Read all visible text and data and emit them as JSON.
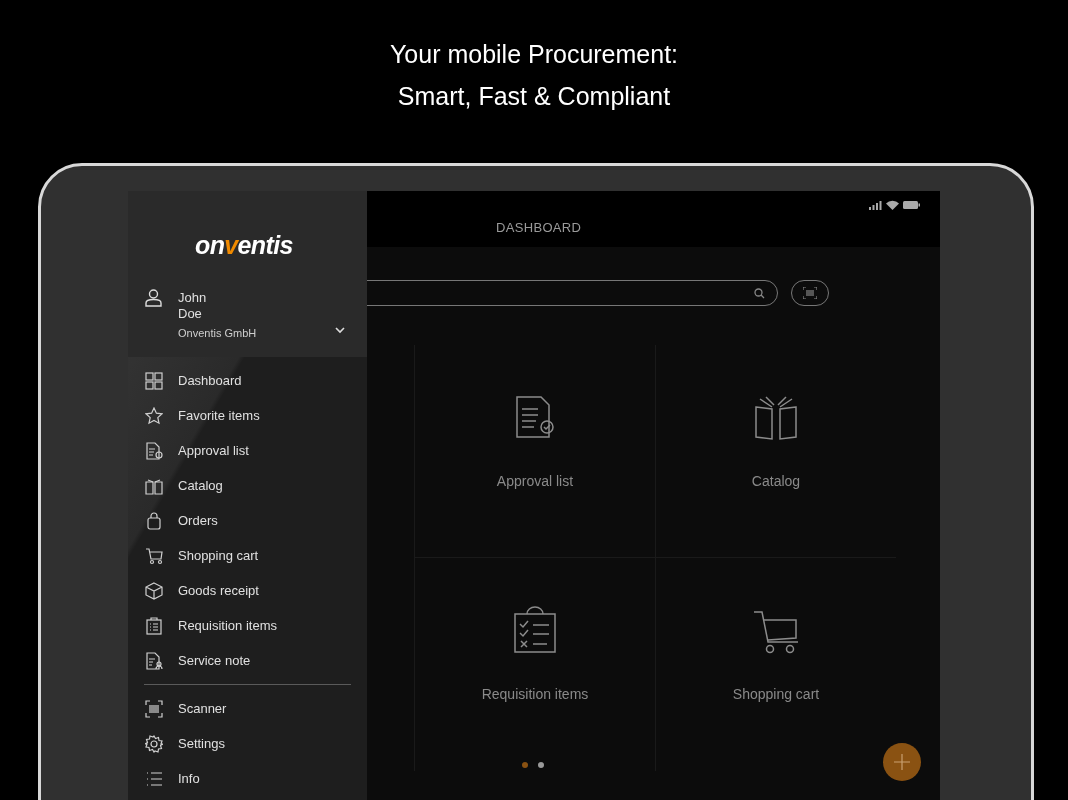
{
  "headline": [
    "Your mobile Procurement:",
    "Smart, Fast & Compliant"
  ],
  "app_bar": {
    "title": "DASHBOARD"
  },
  "drawer": {
    "logo_parts": [
      "on",
      "v",
      "entis"
    ],
    "user": {
      "first_name": "John",
      "last_name": "Doe",
      "company": "Onventis GmbH",
      "expanded": false
    },
    "menu_main": [
      {
        "label": "Dashboard"
      },
      {
        "label": "Favorite items"
      },
      {
        "label": "Approval list"
      },
      {
        "label": "Catalog"
      },
      {
        "label": "Orders"
      },
      {
        "label": "Shopping cart"
      },
      {
        "label": "Goods receipt"
      },
      {
        "label": "Requisition items"
      },
      {
        "label": "Service note"
      }
    ],
    "menu_tools": [
      {
        "label": "Scanner"
      },
      {
        "label": "Settings"
      },
      {
        "label": "Info"
      }
    ]
  },
  "tiles": [
    {
      "label": "Approval list"
    },
    {
      "label": "Catalog"
    },
    {
      "label": "Requisition items"
    },
    {
      "label": "Shopping cart"
    }
  ],
  "page_dots": [
    {
      "selected": true
    },
    {
      "selected": false
    }
  ]
}
